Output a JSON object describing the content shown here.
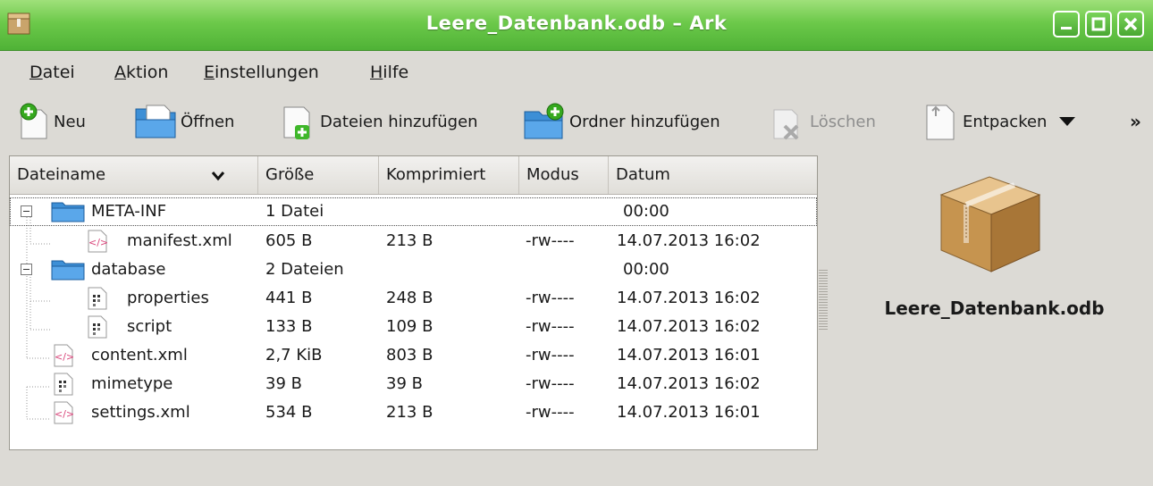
{
  "window": {
    "title": "Leere_Datenbank.odb – Ark"
  },
  "menubar": [
    {
      "pre": "",
      "u": "D",
      "post": "atei"
    },
    {
      "pre": "",
      "u": "A",
      "post": "ktion"
    },
    {
      "pre": "",
      "u": "E",
      "post": "instellungen"
    },
    {
      "pre": "",
      "u": "H",
      "post": "ilfe"
    }
  ],
  "toolbar": {
    "new": "Neu",
    "open": "Öffnen",
    "add_files": "Dateien hinzufügen",
    "add_folder": "Ordner hinzufügen",
    "delete": "Löschen",
    "extract": "Entpacken",
    "overflow": "»"
  },
  "columns": [
    "Dateiname",
    "Größe",
    "Komprimiert",
    "Modus",
    "Datum"
  ],
  "rows": [
    {
      "name": "META-INF",
      "size": "1 Datei",
      "compressed": "",
      "mode": "",
      "date": "00:00",
      "icon": "folder-icon"
    },
    {
      "name": "manifest.xml",
      "size": "605 B",
      "compressed": "213 B",
      "mode": "-rw----",
      "date": "14.07.2013 16:02",
      "icon": "xml-file-icon"
    },
    {
      "name": "database",
      "size": "2 Dateien",
      "compressed": "",
      "mode": "",
      "date": "00:00",
      "icon": "folder-icon"
    },
    {
      "name": "properties",
      "size": "441 B",
      "compressed": "248 B",
      "mode": "-rw----",
      "date": "14.07.2013 16:02",
      "icon": "binary-file-icon"
    },
    {
      "name": "script",
      "size": "133 B",
      "compressed": "109 B",
      "mode": "-rw----",
      "date": "14.07.2013 16:02",
      "icon": "binary-file-icon"
    },
    {
      "name": "content.xml",
      "size": "2,7 KiB",
      "compressed": "803 B",
      "mode": "-rw----",
      "date": "14.07.2013 16:01",
      "icon": "xml-file-icon"
    },
    {
      "name": "mimetype",
      "size": "39 B",
      "compressed": "39 B",
      "mode": "-rw----",
      "date": "14.07.2013 16:02",
      "icon": "binary-file-icon"
    },
    {
      "name": "settings.xml",
      "size": "534 B",
      "compressed": "213 B",
      "mode": "-rw----",
      "date": "14.07.2013 16:01",
      "icon": "xml-file-icon"
    }
  ],
  "preview": {
    "filename": "Leere_Datenbank.odb",
    "icon": "archive-box-icon"
  },
  "colors": {
    "titlebar": "#5cbf3f",
    "folder": "#3d8fd6",
    "xml": "#d9457a"
  }
}
